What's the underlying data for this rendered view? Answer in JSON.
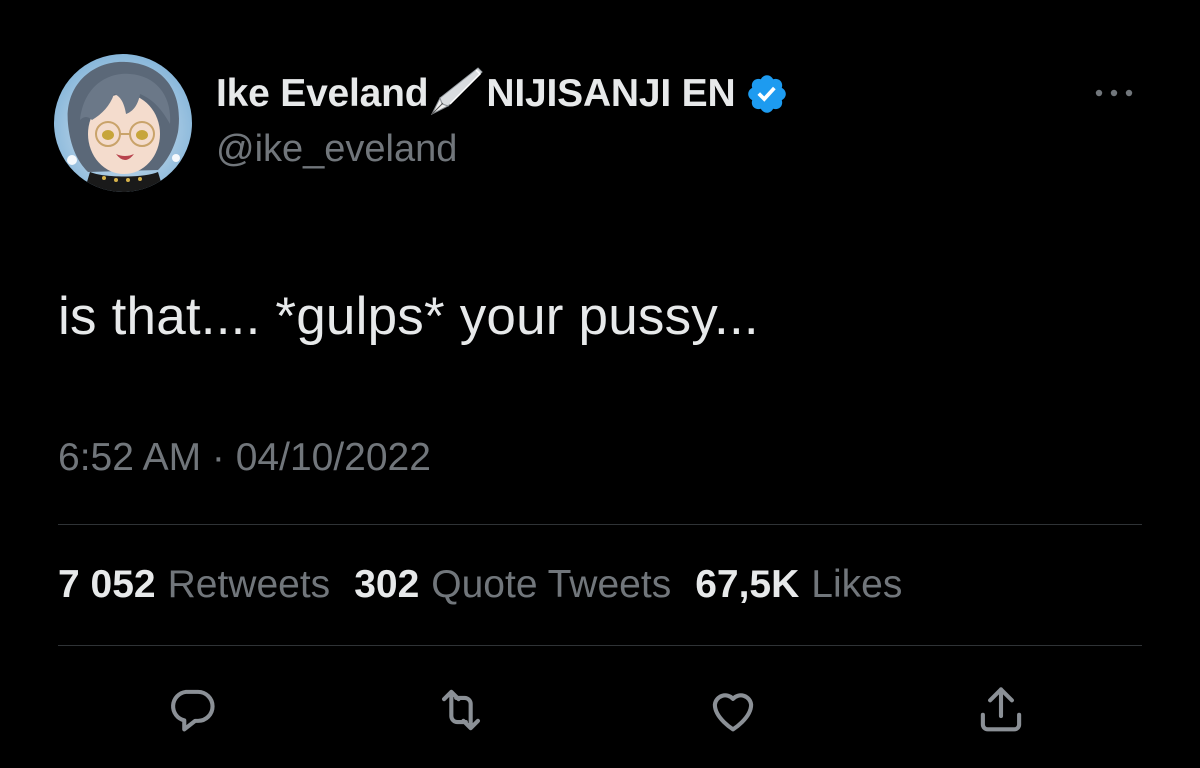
{
  "author": {
    "display_name_first": "Ike Eveland",
    "display_name_second": "NIJISANJI EN",
    "handle": "@ike_eveland",
    "verified": true,
    "avatar_icon": "anime-avatar",
    "name_emoji_icon": "fountain-pen-icon"
  },
  "tweet": {
    "text": "is that.... *gulps* your pussy...",
    "timestamp": "6:52 AM · 04/10/2022"
  },
  "stats": {
    "retweets_count": "7 052",
    "retweets_label": "Retweets",
    "quotes_count": "302",
    "quotes_label": "Quote Tweets",
    "likes_count": "67,5K",
    "likes_label": "Likes"
  },
  "actions": {
    "reply_icon": "reply-icon",
    "retweet_icon": "retweet-icon",
    "like_icon": "heart-icon",
    "share_icon": "share-icon"
  },
  "colors": {
    "background": "#000000",
    "primary_text": "#e7e9ea",
    "secondary_text": "#71767b",
    "divider": "#2f3336",
    "verified_blue": "#1d9bf0"
  }
}
